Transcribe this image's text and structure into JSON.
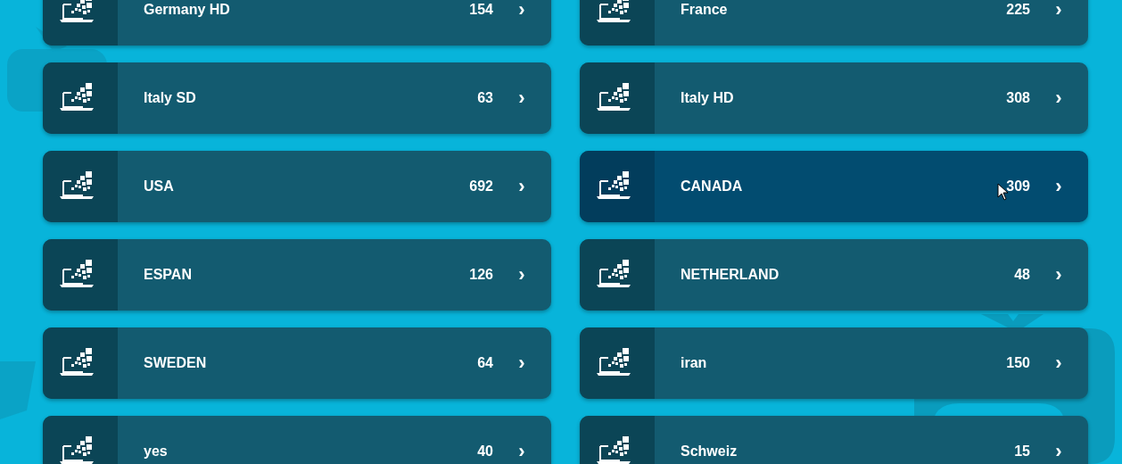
{
  "categories": [
    {
      "name": "Germany HD",
      "count": "154",
      "chevron": "›",
      "selected": false
    },
    {
      "name": "France",
      "count": "225",
      "chevron": "›",
      "selected": false
    },
    {
      "name": "Italy SD",
      "count": "63",
      "chevron": "›",
      "selected": false
    },
    {
      "name": "Italy HD",
      "count": "308",
      "chevron": "›",
      "selected": false
    },
    {
      "name": "USA",
      "count": "692",
      "chevron": "›",
      "selected": false
    },
    {
      "name": "CANADA",
      "count": "309",
      "chevron": "›",
      "selected": true
    },
    {
      "name": "ESPAN",
      "count": "126",
      "chevron": "›",
      "selected": false
    },
    {
      "name": "NETHERLAND",
      "count": "48",
      "chevron": "›",
      "selected": false
    },
    {
      "name": "SWEDEN",
      "count": "64",
      "chevron": "›",
      "selected": false
    },
    {
      "name": "iran",
      "count": "150",
      "chevron": "›",
      "selected": false
    },
    {
      "name": "yes",
      "count": "40",
      "chevron": "›",
      "selected": false
    },
    {
      "name": "Schweiz",
      "count": "15",
      "chevron": "›",
      "selected": false
    }
  ]
}
